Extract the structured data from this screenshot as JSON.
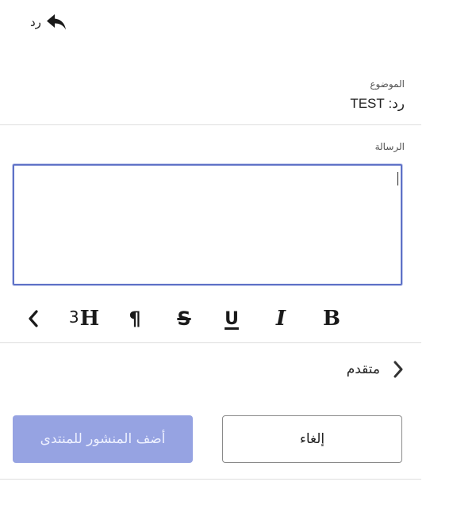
{
  "reply": {
    "label": "رد",
    "icon": "reply-arrow-icon"
  },
  "subject": {
    "label": "الموضوع",
    "value": "رد: TEST"
  },
  "message": {
    "label": "الرسالة",
    "value": ""
  },
  "toolbar": {
    "items": [
      {
        "name": "bold",
        "label": "B"
      },
      {
        "name": "italic",
        "label": "I"
      },
      {
        "name": "underline",
        "label": "U"
      },
      {
        "name": "strikethrough",
        "label": "S"
      },
      {
        "name": "paragraph",
        "label": "¶"
      },
      {
        "name": "heading",
        "label": "H",
        "level": "3"
      },
      {
        "name": "more",
        "icon": "chevron-left-icon"
      }
    ]
  },
  "advanced": {
    "label": "متقدم",
    "icon": "chevron-right-icon"
  },
  "buttons": {
    "cancel_label": "إلغاء",
    "submit_label": "أضف المنشور للمنتدى"
  },
  "colors": {
    "accent_border": "#5f72c7",
    "submit_bg": "#96a3e2",
    "submit_text": "#eef1ff"
  }
}
